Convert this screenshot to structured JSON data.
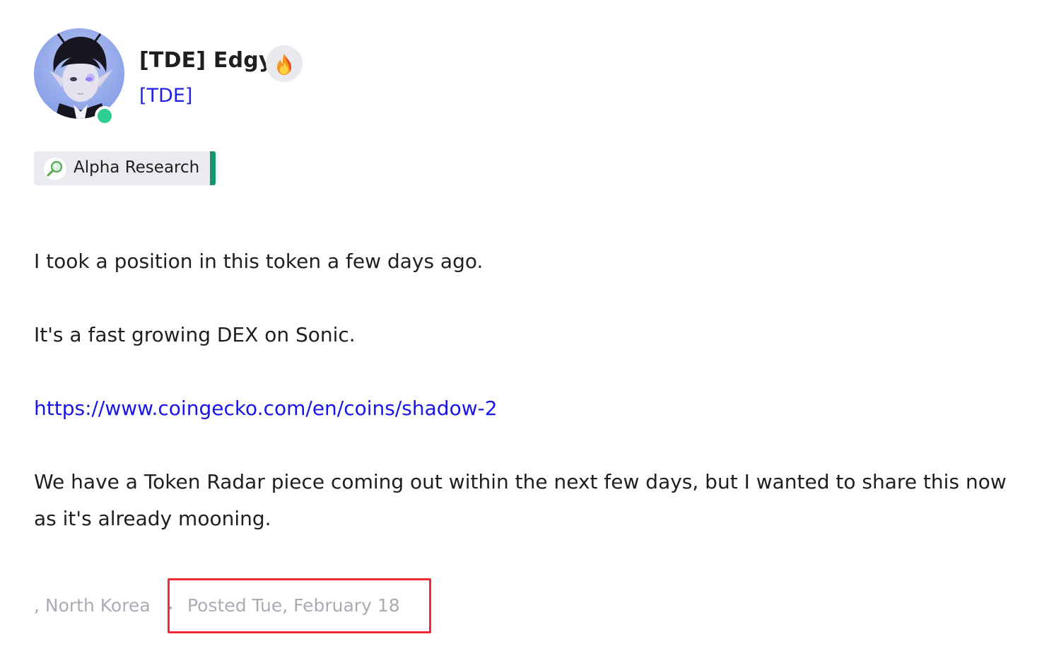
{
  "author": {
    "name": "[TDE] Edgy",
    "handle": "[TDE]",
    "flair_icon": "fire-icon",
    "status": "online",
    "status_color": "#2ecc8f"
  },
  "tag": {
    "icon": "magnifier-icon",
    "label": "Alpha Research",
    "accent_color": "#149472"
  },
  "post": {
    "paragraphs": [
      "I took a position in this token a few days ago.",
      "It's a fast growing DEX on Sonic.",
      "https://www.coingecko.com/en/coins/shadow-2",
      "We have a Token Radar piece coming out within the next few days, but I wanted to share this now as it's already mooning."
    ],
    "link_color": "#1616e6"
  },
  "footer": {
    "location": ", North Korea",
    "posted": "Posted Tue, February 18"
  },
  "highlight_color": "#ee2b3b"
}
